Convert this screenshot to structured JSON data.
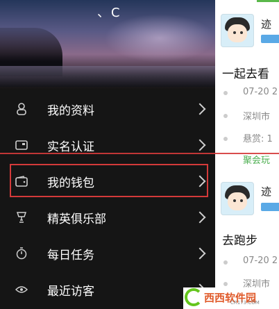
{
  "drawer": {
    "user_name": "、C",
    "items": [
      {
        "label": "我的资料",
        "icon": "person-icon"
      },
      {
        "label": "实名认证",
        "icon": "id-card-icon"
      },
      {
        "label": "我的钱包",
        "icon": "wallet-icon"
      },
      {
        "label": "精英俱乐部",
        "icon": "trophy-icon"
      },
      {
        "label": "每日任务",
        "icon": "timer-icon"
      },
      {
        "label": "最近访客",
        "icon": "eye-icon"
      }
    ]
  },
  "feed": {
    "posts": [
      {
        "user": "迹",
        "title": "一起去看",
        "meta": [
          "07-20 2",
          "深圳市",
          "悬赏: 1"
        ],
        "footer": "聚会玩"
      },
      {
        "user": "迹",
        "title": "去跑步",
        "meta": [
          "07-20 2",
          "深圳市"
        ]
      }
    ]
  },
  "watermark": {
    "text": "西西软件园",
    "url": "CR173.COM"
  },
  "colors": {
    "highlight": "#d43a3a",
    "accent": "#5ab84a"
  }
}
